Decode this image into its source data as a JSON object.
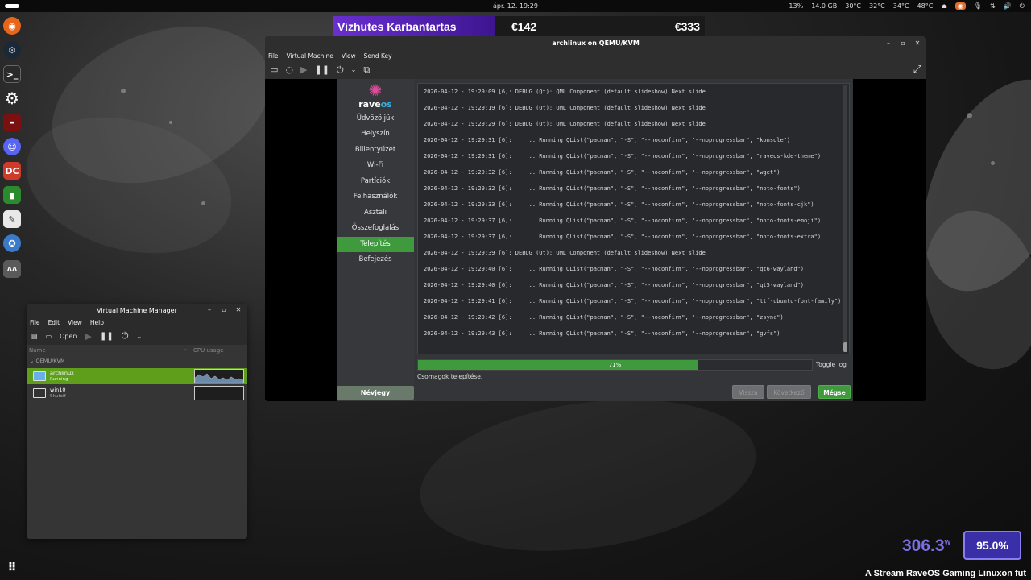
{
  "topbar": {
    "clock": "ápr. 12.  19:29",
    "tray": [
      "13%",
      "14.0 GB",
      "30°C",
      "32°C",
      "34°C",
      "48°C"
    ]
  },
  "banner": {
    "title": "Vizhutes Karbantartas",
    "value1": "€142",
    "value2": "€333"
  },
  "dock": [
    {
      "icon": "firefox-icon",
      "color": "#e8651c"
    },
    {
      "icon": "steam-icon",
      "color": "#1b2838"
    },
    {
      "icon": "terminal-icon",
      "color": "#2a2a2a"
    },
    {
      "icon": "settings-icon",
      "color": "#555555"
    },
    {
      "icon": "game-icon",
      "color": "#7a1010"
    },
    {
      "icon": "discord-icon",
      "color": "#5865f2"
    },
    {
      "icon": "dc-icon",
      "color": "#d03a2a"
    },
    {
      "icon": "phone-icon",
      "color": "#2b8a2b"
    },
    {
      "icon": "editor-icon",
      "color": "#e8e8e8"
    },
    {
      "icon": "installer-icon",
      "color": "#3a7ac8"
    },
    {
      "icon": "media-icon",
      "color": "#5a5a5a"
    }
  ],
  "vm_window": {
    "title": "archlinux on QEMU/KVM",
    "menu": [
      "File",
      "Virtual Machine",
      "View",
      "Send Key"
    ]
  },
  "installer": {
    "brand_left": "rave",
    "brand_right": "os",
    "sidebar": [
      "Üdvözöljük",
      "Helyszín",
      "Billentyűzet",
      "Wi-Fi",
      "Partíciók",
      "Felhasználók",
      "Asztali",
      "Összefoglalás",
      "Telepítés",
      "Befejezés"
    ],
    "active_index": 8,
    "about_button": "Névjegy",
    "log": [
      "2026-04-12 - 19:29:09 [6]: DEBUG (Qt): QML Component (default slideshow) Next slide",
      "2026-04-12 - 19:29:19 [6]: DEBUG (Qt): QML Component (default slideshow) Next slide",
      "2026-04-12 - 19:29:29 [6]: DEBUG (Qt): QML Component (default slideshow) Next slide",
      "2026-04-12 - 19:29:31 [6]:     .. Running QList(\"pacman\", \"-S\", \"--noconfirm\", \"--noprogressbar\", \"konsole\")",
      "2026-04-12 - 19:29:31 [6]:     .. Running QList(\"pacman\", \"-S\", \"--noconfirm\", \"--noprogressbar\", \"raveos-kde-theme\")",
      "2026-04-12 - 19:29:32 [6]:     .. Running QList(\"pacman\", \"-S\", \"--noconfirm\", \"--noprogressbar\", \"wget\")",
      "2026-04-12 - 19:29:32 [6]:     .. Running QList(\"pacman\", \"-S\", \"--noconfirm\", \"--noprogressbar\", \"noto-fonts\")",
      "2026-04-12 - 19:29:33 [6]:     .. Running QList(\"pacman\", \"-S\", \"--noconfirm\", \"--noprogressbar\", \"noto-fonts-cjk\")",
      "2026-04-12 - 19:29:37 [6]:     .. Running QList(\"pacman\", \"-S\", \"--noconfirm\", \"--noprogressbar\", \"noto-fonts-emoji\")",
      "2026-04-12 - 19:29:37 [6]:     .. Running QList(\"pacman\", \"-S\", \"--noconfirm\", \"--noprogressbar\", \"noto-fonts-extra\")",
      "2026-04-12 - 19:29:39 [6]: DEBUG (Qt): QML Component (default slideshow) Next slide",
      "2026-04-12 - 19:29:40 [6]:     .. Running QList(\"pacman\", \"-S\", \"--noconfirm\", \"--noprogressbar\", \"qt6-wayland\")",
      "2026-04-12 - 19:29:40 [6]:     .. Running QList(\"pacman\", \"-S\", \"--noconfirm\", \"--noprogressbar\", \"qt5-wayland\")",
      "2026-04-12 - 19:29:41 [6]:     .. Running QList(\"pacman\", \"-S\", \"--noconfirm\", \"--noprogressbar\", \"ttf-ubuntu-font-family\")",
      "2026-04-12 - 19:29:42 [6]:     .. Running QList(\"pacman\", \"-S\", \"--noconfirm\", \"--noprogressbar\", \"zsync\")",
      "2026-04-12 - 19:29:43 [6]:     .. Running QList(\"pacman\", \"-S\", \"--noconfirm\", \"--noprogressbar\", \"gvfs\")"
    ],
    "progress_fraction": 0.71,
    "progress_label": "71%",
    "toggle_log": "Toggle log",
    "status": "Csomagok telepítése.",
    "buttons": {
      "back": "Vissza",
      "next": "Következő",
      "cancel": "Mégse"
    }
  },
  "vmm": {
    "title": "Virtual Machine Manager",
    "menu": [
      "File",
      "Edit",
      "View",
      "Help"
    ],
    "open_label": "Open",
    "col_name": "Name",
    "col_cpu": "CPU usage",
    "group": "QEMU/KVM",
    "vms": [
      {
        "name": "archlinux",
        "state": "Running",
        "selected": true
      },
      {
        "name": "win10",
        "state": "Shutoff",
        "selected": false
      }
    ]
  },
  "overlay": {
    "watts": "306.3",
    "watts_unit": "W",
    "cpu_pct": "95.0%",
    "ticker": "A Stream RaveOS Gaming Linuxon fut"
  },
  "colors": {
    "accent_green": "#3f9a3d",
    "banner_purple": "#6a2fd0",
    "stat_purple": "#7b6fe8"
  }
}
